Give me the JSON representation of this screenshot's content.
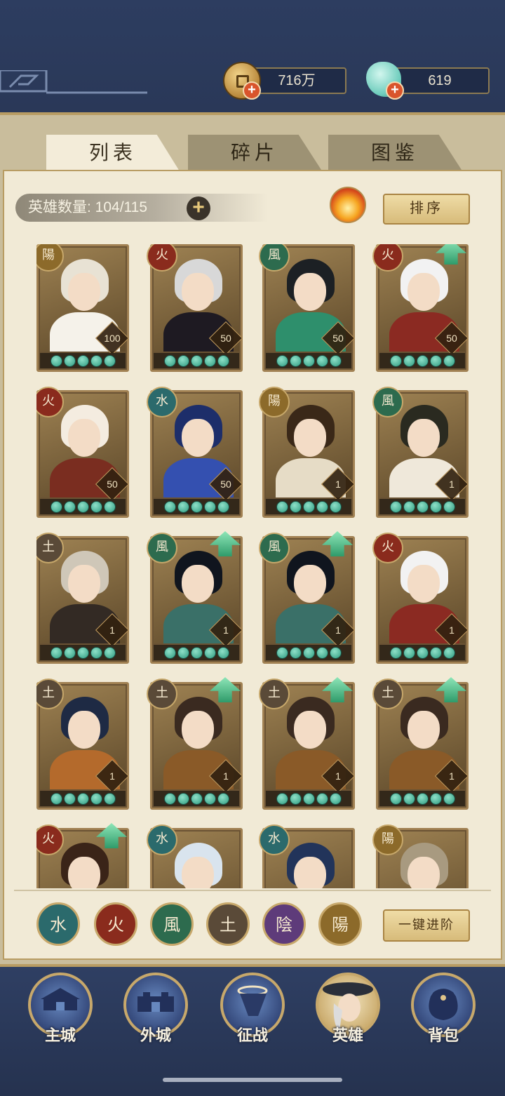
{
  "currency": {
    "coins": "716万",
    "jade": "619"
  },
  "tabs": [
    "列表",
    "碎片",
    "图鉴"
  ],
  "heroes_count": "英雄数量: 104/115",
  "sort_label": "排序",
  "advance_label": "一键进阶",
  "elements": {
    "fire": "火",
    "wind": "風",
    "yang": "陽",
    "water": "水",
    "earth": "土",
    "yin": "陰"
  },
  "heroes": [
    {
      "element": "陽",
      "level": "100",
      "stars": 5,
      "upgrade": false
    },
    {
      "element": "火",
      "level": "50",
      "stars": 5,
      "upgrade": false
    },
    {
      "element": "風",
      "level": "50",
      "stars": 5,
      "upgrade": false
    },
    {
      "element": "火",
      "level": "50",
      "stars": 5,
      "upgrade": true
    },
    {
      "element": "火",
      "level": "50",
      "stars": 5,
      "upgrade": false
    },
    {
      "element": "水",
      "level": "50",
      "stars": 5,
      "upgrade": false
    },
    {
      "element": "陽",
      "level": "1",
      "stars": 5,
      "upgrade": false
    },
    {
      "element": "風",
      "level": "1",
      "stars": 5,
      "upgrade": false
    },
    {
      "element": "土",
      "level": "1",
      "stars": 5,
      "upgrade": false
    },
    {
      "element": "風",
      "level": "1",
      "stars": 5,
      "upgrade": true
    },
    {
      "element": "風",
      "level": "1",
      "stars": 5,
      "upgrade": true
    },
    {
      "element": "火",
      "level": "1",
      "stars": 5,
      "upgrade": false
    },
    {
      "element": "土",
      "level": "1",
      "stars": 5,
      "upgrade": false
    },
    {
      "element": "土",
      "level": "1",
      "stars": 5,
      "upgrade": true
    },
    {
      "element": "土",
      "level": "1",
      "stars": 5,
      "upgrade": true
    },
    {
      "element": "土",
      "level": "1",
      "stars": 5,
      "upgrade": true
    },
    {
      "element": "火",
      "level": "",
      "stars": 0,
      "upgrade": true
    },
    {
      "element": "水",
      "level": "",
      "stars": 0,
      "upgrade": false
    },
    {
      "element": "水",
      "level": "",
      "stars": 0,
      "upgrade": false
    },
    {
      "element": "陽",
      "level": "",
      "stars": 0,
      "upgrade": false
    }
  ],
  "filters": [
    "水",
    "火",
    "風",
    "土",
    "陰",
    "陽"
  ],
  "nav": [
    "主城",
    "外城",
    "征战",
    "英雄",
    "背包"
  ],
  "colors": {
    "panel": "#f1ead6",
    "navy": "#2b3a5c",
    "gold": "#c7a86b"
  }
}
